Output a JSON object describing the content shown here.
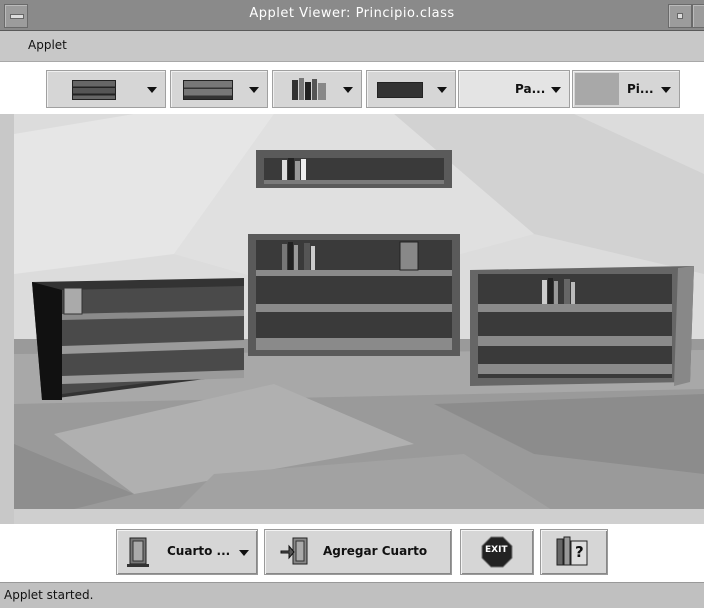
{
  "window": {
    "title": "Applet Viewer: Principio.class"
  },
  "menu": {
    "items": [
      "Applet"
    ]
  },
  "toolbar": {
    "dropdowns": [
      {
        "name": "shelf-style-1",
        "kind": "swatch",
        "label": ""
      },
      {
        "name": "shelf-style-2",
        "kind": "swatch",
        "label": ""
      },
      {
        "name": "books-style",
        "kind": "books",
        "label": ""
      },
      {
        "name": "shelf-style-3",
        "kind": "swatch",
        "label": ""
      },
      {
        "name": "wall-pattern",
        "kind": "text",
        "label": "Pa..."
      },
      {
        "name": "floor-pattern",
        "kind": "text",
        "label": "Pi..."
      }
    ]
  },
  "bottom": {
    "room_select_label": "Cuarto ...",
    "add_room_label": "Agregar Cuarto",
    "exit_label": "EXIT",
    "help_label": "?"
  },
  "status": {
    "text": "Applet started."
  },
  "colors": {
    "titlebar": "#8a8a8a",
    "wall": "#d9d9d9",
    "floor": "#9a9a9a",
    "shelf_dark": "#4a4a4a"
  }
}
